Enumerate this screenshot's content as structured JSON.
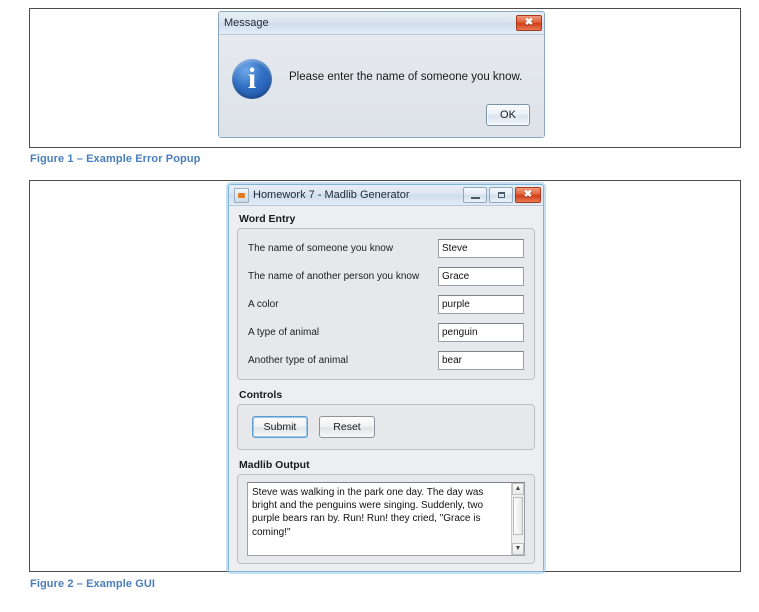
{
  "document": {
    "figures": [
      {
        "caption": "Figure 1 – Example Error Popup",
        "caption_color": "#4a7ebb"
      },
      {
        "caption": "Figure 2 – Example GUI",
        "caption_color": "#4a7ebb"
      }
    ]
  },
  "message_dialog": {
    "title": "Message",
    "icon": "info-icon",
    "icon_glyph": "i",
    "message": "Please enter the name of someone you know.",
    "ok_label": "OK",
    "close_glyph": "✖"
  },
  "madlib_window": {
    "title": "Homework 7 - Madlib Generator",
    "titlebar_buttons": {
      "minimize": "minimize-button",
      "maximize": "maximize-button",
      "close": "close-button",
      "close_glyph": "✖"
    },
    "word_entry": {
      "section_label": "Word Entry",
      "rows": [
        {
          "label": "The name of someone you know",
          "value": "Steve"
        },
        {
          "label": "The name of another person you know",
          "value": "Grace"
        },
        {
          "label": "A color",
          "value": "purple"
        },
        {
          "label": "A type of animal",
          "value": "penguin"
        },
        {
          "label": "Another type of animal",
          "value": "bear"
        }
      ]
    },
    "controls": {
      "section_label": "Controls",
      "submit_label": "Submit",
      "reset_label": "Reset"
    },
    "output": {
      "section_label": "Madlib Output",
      "text": "Steve was walking in the park one day. The day was bright and the penguins were singing. Suddenly, two purple bears ran by. Run! Run! they cried, \"Grace is coming!\"",
      "scroll_up_glyph": "▲",
      "scroll_down_glyph": "▼"
    }
  }
}
